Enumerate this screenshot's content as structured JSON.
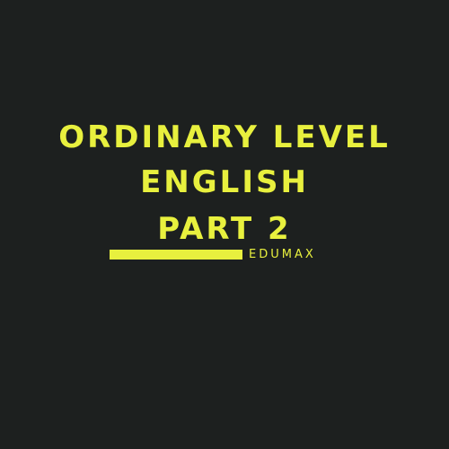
{
  "title": {
    "line1": "ORDINARY LEVEL",
    "line2": "ENGLISH",
    "line3": "PART 2"
  },
  "brand": "EDUMAX",
  "colors": {
    "background": "#1d201f",
    "accent": "#e8f03e"
  }
}
